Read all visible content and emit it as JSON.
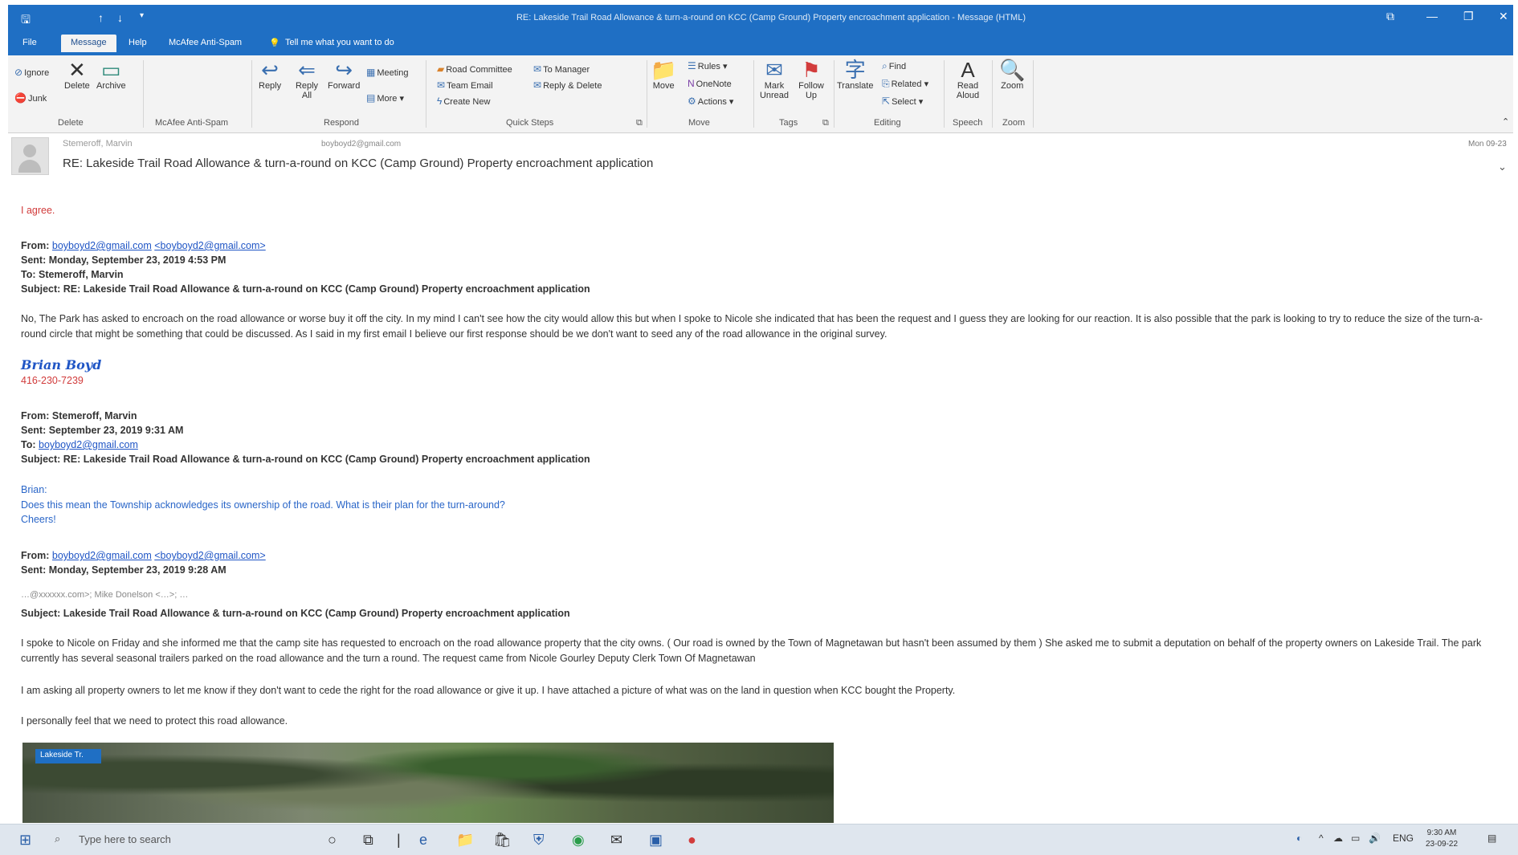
{
  "window": {
    "title": "RE: Lakeside Trail Road Allowance & turn-a-round on KCC (Camp Ground) Property encroachment application - Message (HTML)",
    "quick_access": [
      "↑",
      "↓",
      "▾"
    ]
  },
  "tabs": [
    "File",
    "Message",
    "Help",
    "McAfee Anti-Spam",
    "Tell me what you want to do"
  ],
  "ribbon": {
    "delete": {
      "ignore": "Ignore",
      "junk": "Junk",
      "delete": "Delete",
      "archive": "Archive",
      "group": "Delete"
    },
    "mcafee": {
      "group": "McAfee Anti-Spam"
    },
    "respond": {
      "reply": "Reply",
      "reply_all": "Reply All",
      "forward": "Forward",
      "meeting": "Meeting",
      "more": "More",
      "group": "Respond"
    },
    "quick_steps": {
      "items": [
        "Road Committee",
        "Team Email",
        "Create New",
        "To Manager",
        "Reply & Delete"
      ],
      "group": "Quick Steps"
    },
    "move": {
      "move": "Move",
      "rules": "Rules",
      "onenote": "OneNote",
      "actions": "Actions",
      "group": "Move"
    },
    "tags": {
      "mark_unread": "Mark Unread",
      "follow_up": "Follow Up",
      "group": "Tags"
    },
    "editing": {
      "translate": "Translate",
      "find": "Find",
      "related": "Related",
      "select": "Select",
      "group": "Editing"
    },
    "speech": {
      "read_aloud": "Read Aloud",
      "group": "Speech"
    },
    "zoom": {
      "zoom": "Zoom",
      "group": "Zoom"
    }
  },
  "header": {
    "sender": "Stemeroff, Marvin",
    "to": "boyboyd2@gmail.com",
    "date": "Mon 09-23",
    "subject": "RE: Lakeside Trail Road Allowance & turn-a-round on KCC (Camp Ground) Property encroachment application"
  },
  "body": {
    "agree": "I agree.",
    "msg1": {
      "from_label": "From:",
      "from_link": "boyboyd2@gmail.com",
      "from_link2": "<boyboyd2@gmail.com>",
      "sent": "Sent: Monday, September 23, 2019 4:53 PM",
      "to": "To: Stemeroff, Marvin",
      "subject": "Subject: RE: Lakeside Trail Road Allowance & turn-a-round on KCC (Camp Ground) Property encroachment application",
      "text": "No, The Park has asked to encroach on the road allowance or worse buy it off the city. In my mind I can't see how the city would allow this but when I spoke to Nicole she indicated that has been the request and I guess they are looking for our reaction. It is also possible that the park is looking to try to reduce the size of the turn-a-round circle that might be something that could be discussed. As I said in my first email I believe our first response should be we don't want to seed any of the road allowance in the original survey."
    },
    "signature": {
      "name": "Brian Boyd",
      "phone": "416-230-7239"
    },
    "msg2": {
      "from": "From: Stemeroff, Marvin",
      "sent": "Sent: September 23, 2019 9:31 AM",
      "to_label": "To:",
      "to_link": "boyboyd2@gmail.com",
      "subject": "Subject: RE: Lakeside Trail Road Allowance & turn-a-round on KCC (Camp Ground) Property encroachment application",
      "greeting": "Brian:",
      "question": "Does this mean the Township acknowledges its ownership of the road. What is their plan for the turn-around?",
      "closing": "Cheers!"
    },
    "msg3": {
      "from_label": "From:",
      "from_link": "boyboyd2@gmail.com",
      "from_link2": "<boyboyd2@gmail.com>",
      "sent": "Sent: Monday, September 23, 2019 9:28 AM",
      "cc_partial": "…@xxxxxx.com>; Mike Donelson <…>; …",
      "subject": "Subject: Lakeside Trail Road Allowance & turn-a-round on KCC (Camp Ground) Property encroachment application",
      "p1": "I spoke to Nicole on Friday and she informed me that the camp site has requested to encroach on the road allowance property that the city owns. ( Our road is owned by the Town of Magnetawan but hasn't been assumed by them ) She asked me to submit a deputation on behalf of the property owners on Lakeside Trail. The park currently has several seasonal trailers parked on the road allowance and the turn a round. The request came from Nicole Gourley Deputy Clerk Town Of Magnetawan",
      "p2": "I am asking all property owners to let me know if they don't want to cede the right for the road allowance or give it up. I have attached a picture of what was on the land in question when KCC bought the Property.",
      "p3": "I personally feel that we need to protect this road allowance."
    },
    "photo_label": "Lakeside Tr."
  },
  "taskbar": {
    "search_placeholder": "Type here to search",
    "time": "9:30 AM",
    "date": "23-09-22",
    "lang": "ENG"
  }
}
